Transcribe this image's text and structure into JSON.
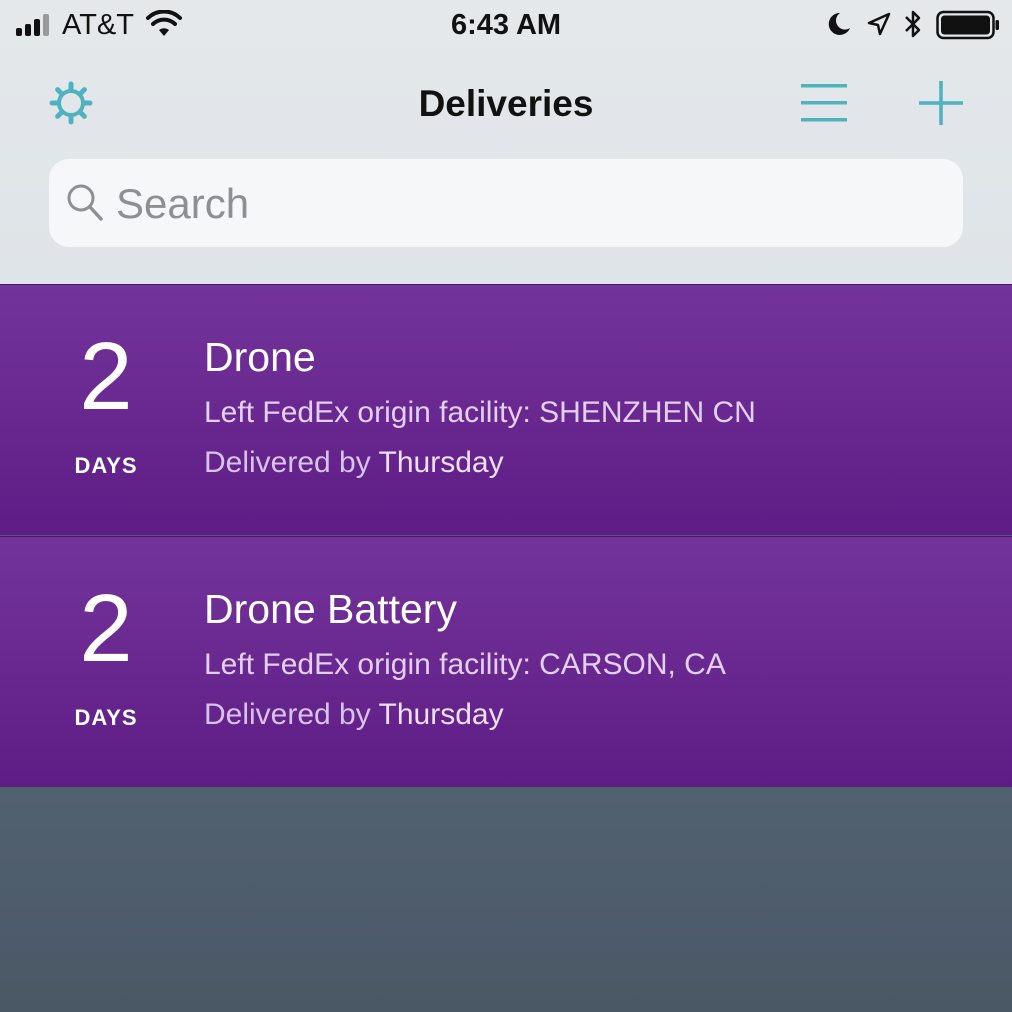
{
  "status_bar": {
    "carrier": "AT&T",
    "time": "6:43 AM"
  },
  "nav": {
    "title": "Deliveries"
  },
  "search": {
    "placeholder": "Search"
  },
  "deliveries": [
    {
      "days": "2",
      "days_label": "DAYS",
      "name": "Drone",
      "status": "Left FedEx origin facility: SHENZHEN CN",
      "eta_prefix": "Delivered by",
      "eta_day": "Thursday"
    },
    {
      "days": "2",
      "days_label": "DAYS",
      "name": "Drone Battery",
      "status": "Left FedEx origin facility: CARSON, CA",
      "eta_prefix": "Delivered by",
      "eta_day": "Thursday"
    }
  ],
  "icons": {
    "settings": "gear-icon",
    "list": "menu-icon",
    "add": "plus-icon",
    "search": "search-icon"
  },
  "colors": {
    "accent": "#4fb3bf",
    "row": "#6a2a92",
    "empty": "#4e5e6a"
  }
}
